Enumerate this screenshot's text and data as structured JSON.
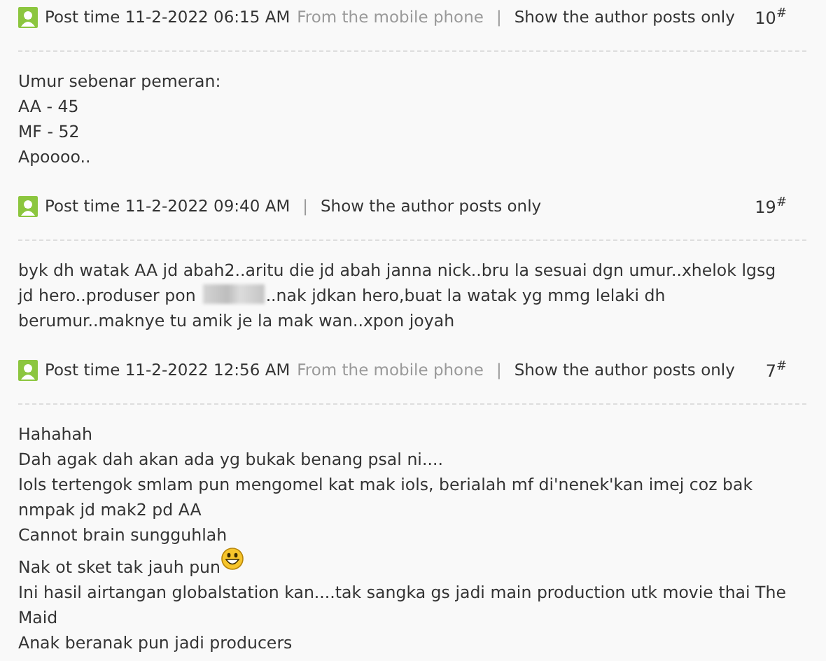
{
  "posts": [
    {
      "post_time": "Post time 11-2-2022 06:15 AM",
      "source": "From the mobile phone",
      "separator": "|",
      "author_link": "Show the author posts only",
      "floor": "10",
      "floor_mark": "#",
      "lines": [
        {
          "parts": [
            {
              "kind": "text",
              "text": "Umur sebenar pemeran:"
            }
          ]
        },
        {
          "parts": [
            {
              "kind": "text",
              "text": "AA - 45"
            }
          ]
        },
        {
          "parts": [
            {
              "kind": "text",
              "text": "MF - 52"
            }
          ]
        },
        {
          "parts": [
            {
              "kind": "text",
              "text": "Apoooo.."
            }
          ]
        }
      ]
    },
    {
      "post_time": "Post time 11-2-2022 09:40 AM",
      "separator": "|",
      "author_link": "Show the author posts only",
      "floor": "19",
      "floor_mark": "#",
      "lines": [
        {
          "parts": [
            {
              "kind": "text",
              "text": "byk dh watak AA jd abah2..aritu die jd abah janna nick..bru la sesuai dgn umur..xhelok lgsg"
            }
          ]
        },
        {
          "parts": [
            {
              "kind": "text",
              "text": "jd hero..produser pon"
            },
            {
              "kind": "redacted"
            },
            {
              "kind": "text",
              "text": "..nak jdkan hero,buat la watak yg mmg lelaki dh"
            }
          ]
        },
        {
          "parts": [
            {
              "kind": "text",
              "text": "berumur..maknye tu amik je la mak wan..xpon joyah"
            }
          ]
        }
      ]
    },
    {
      "post_time": "Post time 11-2-2022 12:56 AM",
      "source": "From the mobile phone",
      "separator": "|",
      "author_link": "Show the author posts only",
      "floor": "7",
      "floor_mark": "#",
      "lines": [
        {
          "parts": [
            {
              "kind": "text",
              "text": "Hahahah"
            }
          ]
        },
        {
          "parts": [
            {
              "kind": "text",
              "text": "Dah agak dah akan ada yg bukak benang psal ni...."
            }
          ]
        },
        {
          "parts": [
            {
              "kind": "text",
              "text": "Iols tertengok smlam pun mengomel kat mak iols, berialah mf di'nenek'kan imej coz bak nmpak jd mak2 pd AA"
            }
          ]
        },
        {
          "parts": [
            {
              "kind": "text",
              "text": "Cannot brain sungguhlah"
            }
          ]
        },
        {
          "parts": [
            {
              "kind": "text",
              "text": "Nak ot sket tak jauh pun"
            },
            {
              "kind": "smiley"
            }
          ]
        },
        {
          "parts": [
            {
              "kind": "text",
              "text": "Ini hasil airtangan globalstation kan....tak sangka gs jadi main production utk movie thai The Maid"
            }
          ]
        },
        {
          "parts": [
            {
              "kind": "text",
              "text": "Anak beranak pun jadi producers"
            }
          ]
        }
      ]
    }
  ]
}
